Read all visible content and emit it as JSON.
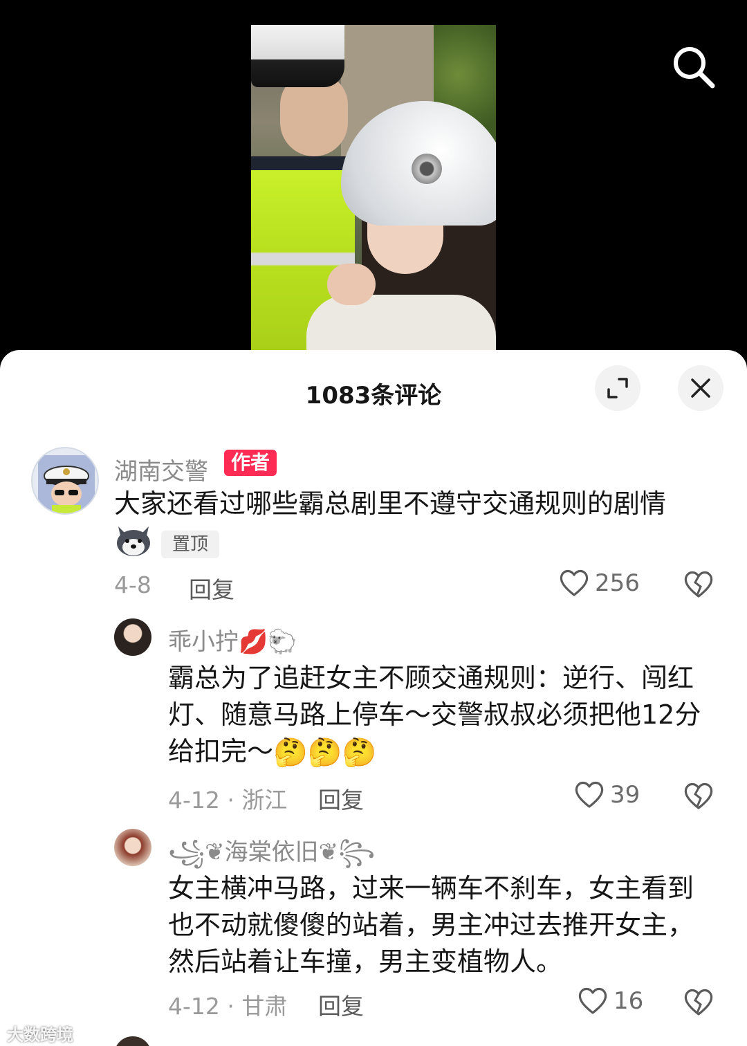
{
  "sheet": {
    "title": "1083条评论"
  },
  "comments": [
    {
      "username": "湖南交警",
      "badge": "作者",
      "text": "大家还看过哪些霸总剧里不遵守交通规则的剧情",
      "pinned": "置顶",
      "date": "4-8",
      "reply": "回复",
      "likes": "256"
    },
    {
      "username": "乖小拧💋🐑",
      "text": "霸总为了追赶女主不顾交通规则：逆行、闯红灯、随意马路上停车～交警叔叔必须把他12分给扣完～",
      "emojis": "🤔🤔🤔",
      "date": "4-12 · 浙江",
      "reply": "回复",
      "likes": "39"
    },
    {
      "username": "꧁❦海棠依旧❦꧂",
      "text": "女主横冲马路，过来一辆车不刹车，女主看到也不动就傻傻的站着，男主冲过去推开女主，然后站着让车撞，男主变植物人。",
      "date": "4-12 · 甘肃",
      "reply": "回复",
      "likes": "16"
    }
  ],
  "watermark": "大数跨境"
}
